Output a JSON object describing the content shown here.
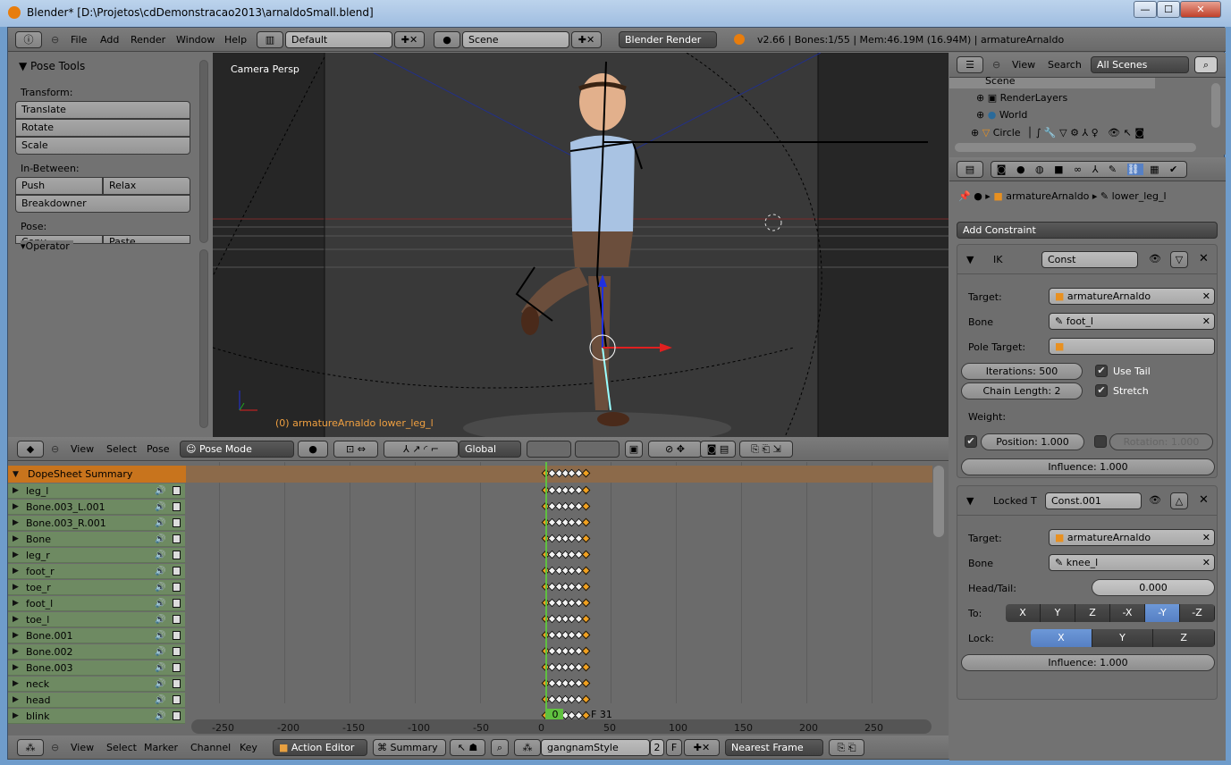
{
  "window": {
    "title": "Blender* [D:\\Projetos\\cdDemonstracao2013\\arnaldoSmall.blend]",
    "minimize": "—",
    "maximize": "☐",
    "close": "✕"
  },
  "info_header": {
    "menus": [
      "File",
      "Add",
      "Render",
      "Window",
      "Help"
    ],
    "layout": "Default",
    "scene": "Scene",
    "engine": "Blender Render",
    "stats": "v2.66 | Bones:1/55 | Mem:46.19M (16.94M) | armatureArnaldo"
  },
  "tool_panel": {
    "title": "Pose Tools",
    "transform_label": "Transform:",
    "translate": "Translate",
    "rotate": "Rotate",
    "scale": "Scale",
    "inbetween_label": "In-Between:",
    "push": "Push",
    "relax": "Relax",
    "breakdowner": "Breakdowner",
    "pose_label": "Pose:",
    "copy": "Copy",
    "paste": "Paste",
    "operator": "Operator"
  },
  "viewport": {
    "view_name": "Camera Persp",
    "object_info": "(0) armatureArnaldo lower_leg_l",
    "colors": {
      "x_axis": "#e02020",
      "y_axis": "#20a020",
      "z_axis": "#2030e0"
    }
  },
  "view3d_header": {
    "menus": [
      "View",
      "Select",
      "Pose"
    ],
    "mode": "Pose Mode",
    "orientation": "Global"
  },
  "outliner": {
    "menus": [
      "View",
      "Search"
    ],
    "filter": "All Scenes",
    "items": [
      {
        "label": "Scene"
      },
      {
        "label": "RenderLayers"
      },
      {
        "label": "World"
      },
      {
        "label": "Circle"
      }
    ]
  },
  "properties": {
    "breadcrumb": [
      "armatureArnaldo",
      "lower_leg_l"
    ],
    "add_constraint": "Add Constraint",
    "ik": {
      "type": "IK",
      "name": "Const",
      "target_label": "Target:",
      "target": "armatureArnaldo",
      "bone_label": "Bone",
      "bone": "foot_l",
      "pole_label": "Pole Target:",
      "iterations": "Iterations: 500",
      "chain": "Chain Length: 2",
      "use_tail": "Use Tail",
      "use_tail_checked": true,
      "stretch": "Stretch",
      "stretch_checked": true,
      "weight_label": "Weight:",
      "position": "Position: 1.000",
      "position_checked": true,
      "rotation": "Rotation: 1.000",
      "rotation_checked": false,
      "influence": "Influence: 1.000"
    },
    "locked": {
      "type": "Locked T",
      "name": "Const.001",
      "target_label": "Target:",
      "target": "armatureArnaldo",
      "bone_label": "Bone",
      "bone": "knee_l",
      "headtail_label": "Head/Tail:",
      "headtail": "0.000",
      "to_label": "To:",
      "to_options": [
        "X",
        "Y",
        "Z",
        "-X",
        "-Y",
        "-Z"
      ],
      "to_selected": "-Y",
      "lock_label": "Lock:",
      "lock_options": [
        "X",
        "Y",
        "Z"
      ],
      "lock_selected": "X",
      "influence": "Influence: 1.000"
    }
  },
  "dopesheet": {
    "summary": "DopeSheet Summary",
    "channels": [
      "leg_l",
      "Bone.003_L.001",
      "Bone.003_R.001",
      "Bone",
      "leg_r",
      "foot_r",
      "toe_r",
      "foot_l",
      "toe_l",
      "Bone.001",
      "Bone.002",
      "Bone.003",
      "neck",
      "head",
      "blink"
    ],
    "keyframes": [
      0,
      5,
      10,
      15,
      20,
      25,
      31
    ],
    "current_frame": "0",
    "end_marker": "F 31",
    "ruler": [
      "-250",
      "-200",
      "-150",
      "-100",
      "-50",
      "0",
      "50",
      "100",
      "150",
      "200",
      "250"
    ],
    "colors": {
      "summary": "#c8741d",
      "channel": "#6e8a62",
      "playhead": "#60c040"
    }
  },
  "dopesheet_header": {
    "menus": [
      "View",
      "Select",
      "Marker",
      "Channel",
      "Key"
    ],
    "mode": "Action Editor",
    "summary": "Summary",
    "action": "gangnamStyle",
    "users": "2",
    "fake": "F",
    "snap": "Nearest Frame"
  }
}
